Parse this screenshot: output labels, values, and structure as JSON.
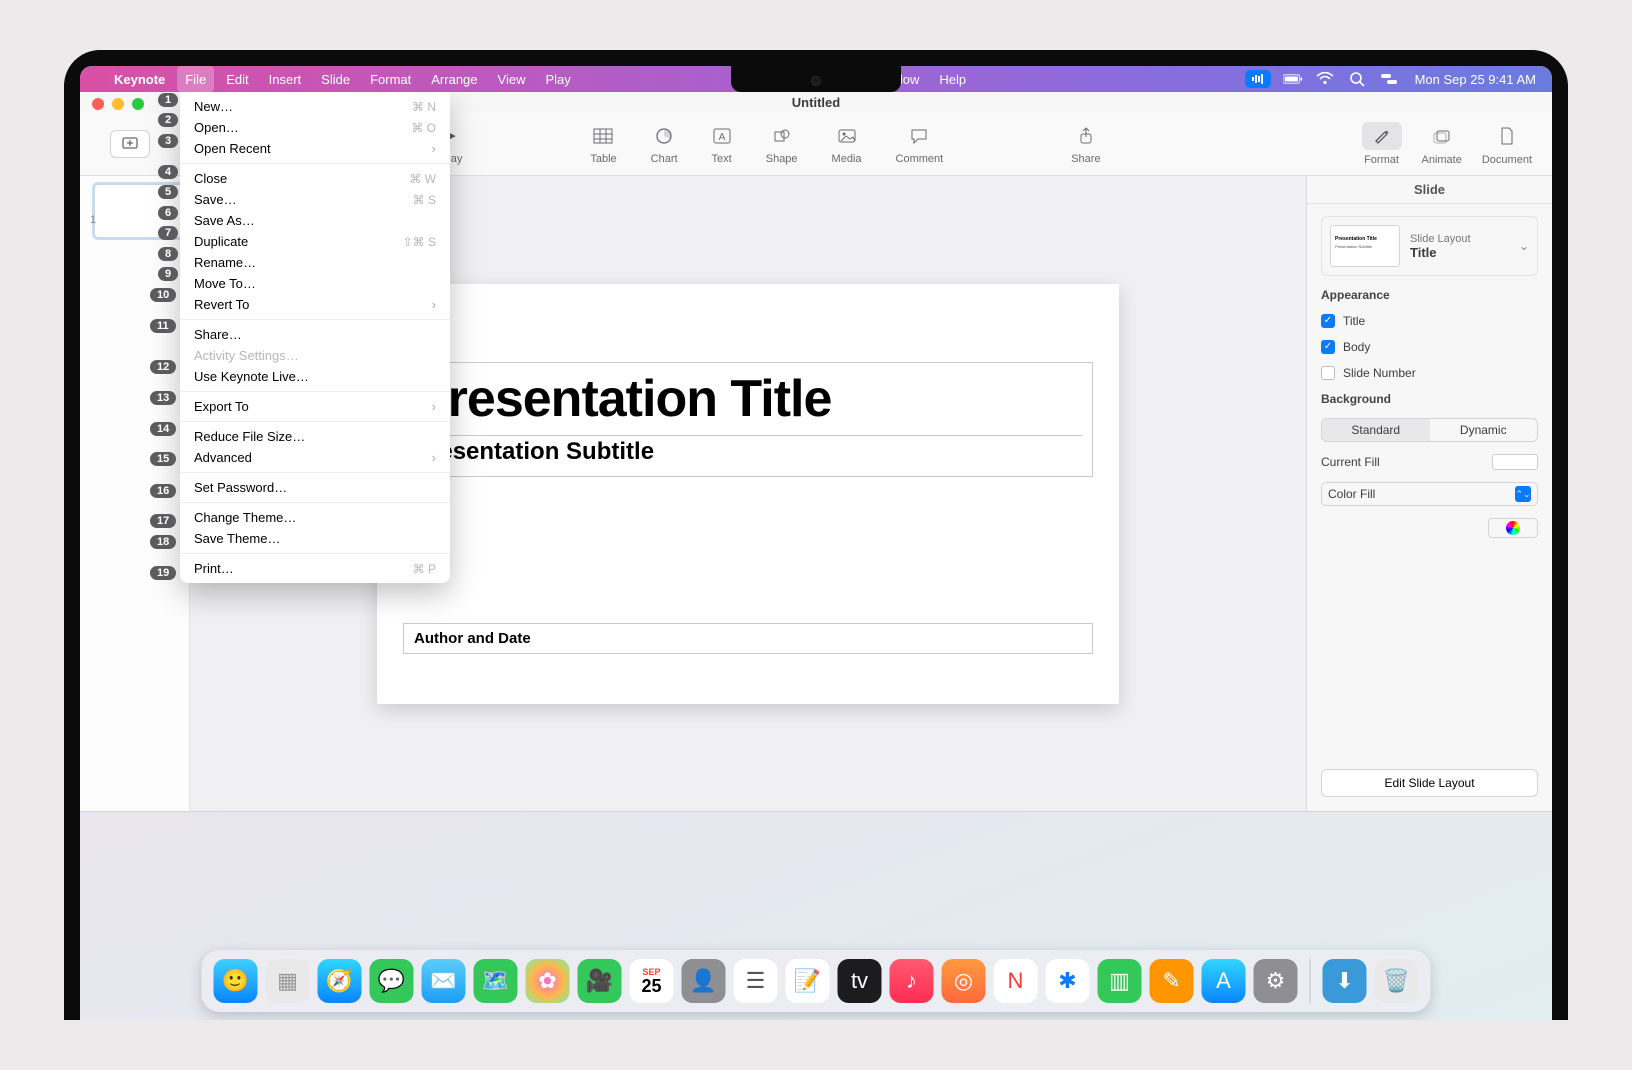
{
  "menubar": {
    "app": "Keynote",
    "items": [
      "File",
      "Edit",
      "Insert",
      "Slide",
      "Format",
      "Arrange",
      "View",
      "Play",
      "Window",
      "Help"
    ],
    "clock": "Mon Sep 25  9:41 AM"
  },
  "window": {
    "title": "Untitled",
    "toolbar": {
      "play": "Play",
      "table": "Table",
      "chart": "Chart",
      "text": "Text",
      "shape": "Shape",
      "media": "Media",
      "comment": "Comment",
      "share": "Share",
      "format": "Format",
      "animate": "Animate",
      "document": "Document"
    },
    "thumb_number": "1"
  },
  "slide": {
    "title": "Presentation Title",
    "subtitle": "Presentation Subtitle",
    "author": "Author and Date"
  },
  "inspector": {
    "tab": "Slide",
    "layout_label": "Slide Layout",
    "layout_name": "Title",
    "appearance": "Appearance",
    "title_chk": "Title",
    "body_chk": "Body",
    "slidenum_chk": "Slide Number",
    "background": "Background",
    "standard": "Standard",
    "dynamic": "Dynamic",
    "currentfill": "Current Fill",
    "colorfill": "Color Fill",
    "editlayout": "Edit Slide Layout"
  },
  "file_menu": [
    {
      "label": "New…",
      "shortcut": "⌘ N"
    },
    {
      "label": "Open…",
      "shortcut": "⌘ O"
    },
    {
      "label": "Open Recent",
      "submenu": true
    },
    {
      "sep": true
    },
    {
      "label": "Close",
      "shortcut": "⌘ W"
    },
    {
      "label": "Save…",
      "shortcut": "⌘ S"
    },
    {
      "label": "Save As…"
    },
    {
      "label": "Duplicate",
      "shortcut": "⇧⌘ S"
    },
    {
      "label": "Rename…"
    },
    {
      "label": "Move To…"
    },
    {
      "label": "Revert To",
      "submenu": true
    },
    {
      "sep": true
    },
    {
      "label": "Share…"
    },
    {
      "label": "Activity Settings…",
      "disabled": true
    },
    {
      "label": "Use Keynote Live…"
    },
    {
      "sep": true
    },
    {
      "label": "Export To",
      "submenu": true
    },
    {
      "sep": true
    },
    {
      "label": "Reduce File Size…"
    },
    {
      "label": "Advanced",
      "submenu": true
    },
    {
      "sep": true
    },
    {
      "label": "Set Password…"
    },
    {
      "sep": true
    },
    {
      "label": "Change Theme…"
    },
    {
      "label": "Save Theme…"
    },
    {
      "sep": true
    },
    {
      "label": "Print…",
      "shortcut": "⌘ P"
    }
  ],
  "badges": [
    "1",
    "2",
    "3",
    "4",
    "5",
    "6",
    "7",
    "8",
    "9",
    "10",
    "11",
    "12",
    "13",
    "14",
    "15",
    "16",
    "17",
    "18",
    "19"
  ],
  "dock_apps": [
    "Finder",
    "Launchpad",
    "Safari",
    "Messages",
    "Mail",
    "Maps",
    "Photos",
    "FaceTime",
    "Calendar",
    "Contacts",
    "Reminders",
    "Notes",
    "TV",
    "Music",
    "Podcasts",
    "News",
    "Stocks",
    "Numbers",
    "Pages",
    "App Store",
    "Settings"
  ]
}
